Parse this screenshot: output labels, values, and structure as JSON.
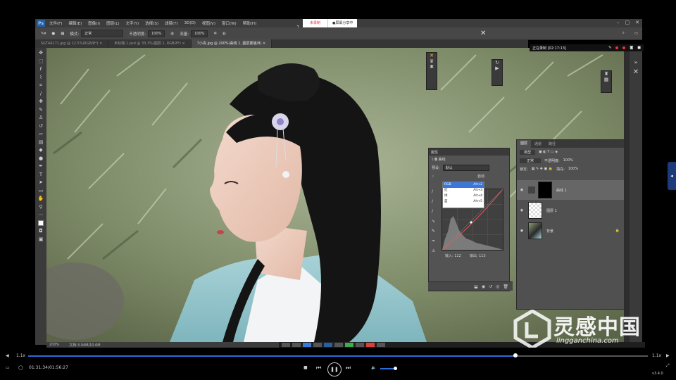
{
  "menubar": {
    "logo": "Ps",
    "items": [
      "文件(F)",
      "编辑(E)",
      "图像(I)",
      "图层(L)",
      "文字(Y)",
      "选择(S)",
      "滤镜(T)",
      "3D(D)",
      "视图(V)",
      "窗口(W)",
      "帮助(H)"
    ],
    "recording_stop": "未录制",
    "screen_share": "●屏幕分享中",
    "counter": "1"
  },
  "options": {
    "mode_label": "模式:",
    "mode_value": "正常",
    "opacity_label": "不透明度:",
    "opacity_value": "100%",
    "flow_label": "流量:",
    "flow_value": "100%"
  },
  "tabs": [
    {
      "label": "SGT4A171.jpg @ 12.5%(RGB/8*)",
      "active": false
    },
    {
      "label": "未标题-1.psd @ 33.3%(图层 1, RGB/8*)",
      "active": false
    },
    {
      "label": "7小青.jpg @ 200%(曲线 1, 图层蒙版/8)",
      "active": true
    }
  ],
  "status": {
    "zoom": "200%",
    "doc": "文档:3.04M/10.6M"
  },
  "recorder": {
    "text": "正在录制 [02:17:13]"
  },
  "curves": {
    "header": "属性",
    "title": "曲线",
    "preset_label": "预设:",
    "preset_value": "默认",
    "auto": "自动",
    "dropdown": [
      {
        "name": "RGB",
        "shortcut": "Alt+2",
        "selected": true
      },
      {
        "name": "红",
        "shortcut": "Alt+3",
        "selected": false
      },
      {
        "name": "绿",
        "shortcut": "Alt+4",
        "selected": false
      },
      {
        "name": "蓝",
        "shortcut": "Alt+5",
        "selected": false
      }
    ],
    "input_label": "输入:",
    "input_value": "122",
    "output_label": "输出:",
    "output_value": "113"
  },
  "layers": {
    "tabs": [
      "图层",
      "通道",
      "路径"
    ],
    "filter_value": "类型",
    "blend_value": "正常",
    "opacity_label": "不透明度:",
    "opacity_value": "100%",
    "lock_label": "锁定:",
    "fill_label": "填充:",
    "fill_value": "100%",
    "items": [
      {
        "name": "曲线 1",
        "kind": "adjust"
      },
      {
        "name": "图层 1",
        "kind": "transparent"
      },
      {
        "name": "背景",
        "kind": "photo"
      }
    ]
  },
  "player": {
    "speed": "1.1x",
    "time": "01:31:34/01:56:27",
    "speed_right": "1.1x",
    "version": "v3.4.0",
    "progress": 0.786
  },
  "watermark": {
    "title": "灵感中国",
    "url": "lingganchina.com"
  },
  "colors": {
    "accent": "#2a6cd9",
    "ps_logo": "#2a5f9e"
  }
}
